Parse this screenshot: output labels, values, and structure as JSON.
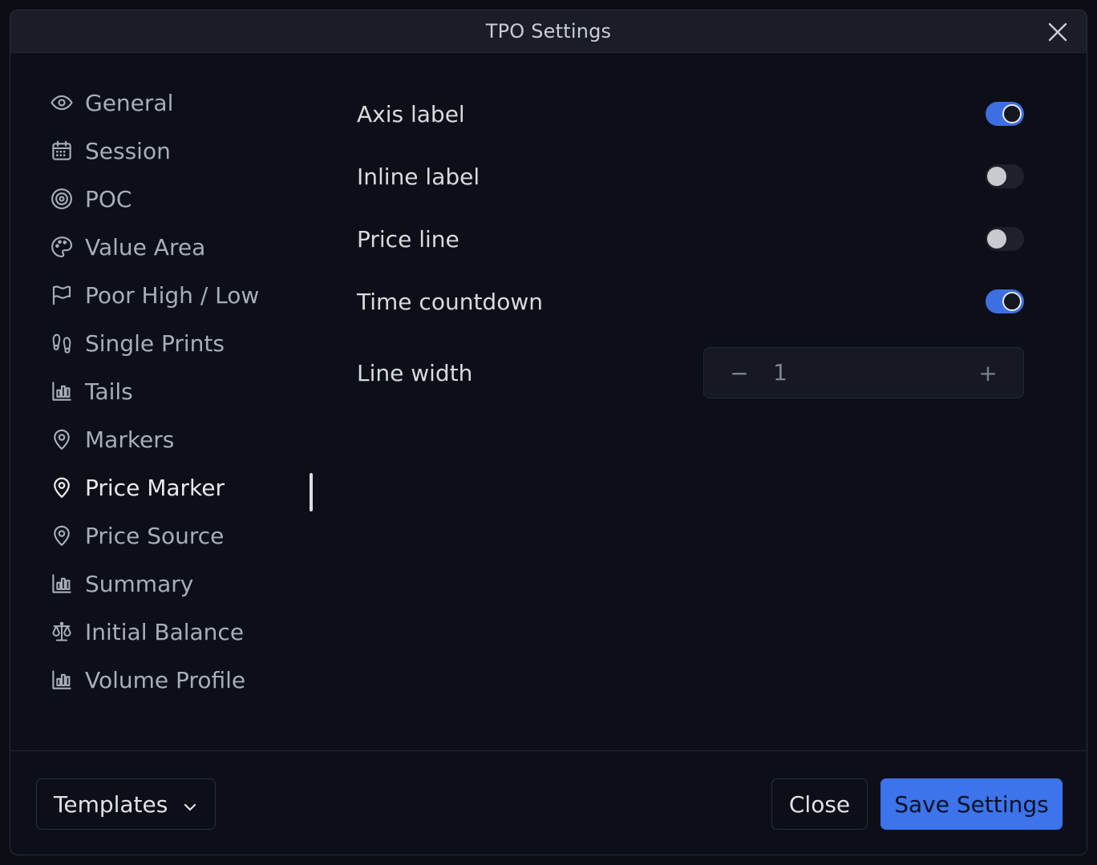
{
  "dialog": {
    "title": "TPO Settings"
  },
  "sidebar": {
    "items": [
      {
        "label": "General",
        "icon": "eye-icon"
      },
      {
        "label": "Session",
        "icon": "calendar-icon"
      },
      {
        "label": "POC",
        "icon": "target-icon"
      },
      {
        "label": "Value Area",
        "icon": "palette-icon"
      },
      {
        "label": "Poor High / Low",
        "icon": "flag-icon"
      },
      {
        "label": "Single Prints",
        "icon": "footprints-icon"
      },
      {
        "label": "Tails",
        "icon": "bar-chart-icon"
      },
      {
        "label": "Markers",
        "icon": "map-pin-icon"
      },
      {
        "label": "Price Marker",
        "icon": "map-pin-icon"
      },
      {
        "label": "Price Source",
        "icon": "map-pin-icon"
      },
      {
        "label": "Summary",
        "icon": "bar-chart-icon"
      },
      {
        "label": "Initial Balance",
        "icon": "scale-icon"
      },
      {
        "label": "Volume Profile",
        "icon": "bar-chart-icon"
      }
    ],
    "active_label": "Price Marker"
  },
  "settings": {
    "axis_label": {
      "label": "Axis label",
      "enabled": true
    },
    "inline_label": {
      "label": "Inline label",
      "enabled": false
    },
    "price_line": {
      "label": "Price line",
      "enabled": false
    },
    "time_countdown": {
      "label": "Time countdown",
      "enabled": true
    },
    "line_width": {
      "label": "Line width",
      "value": "1",
      "minus": "−",
      "plus": "+"
    }
  },
  "footer": {
    "templates_label": "Templates",
    "close_label": "Close",
    "save_label": "Save Settings"
  },
  "colors": {
    "accent": "#3d73eb",
    "background": "#0c0f17",
    "titlebar": "#1a1d26"
  }
}
